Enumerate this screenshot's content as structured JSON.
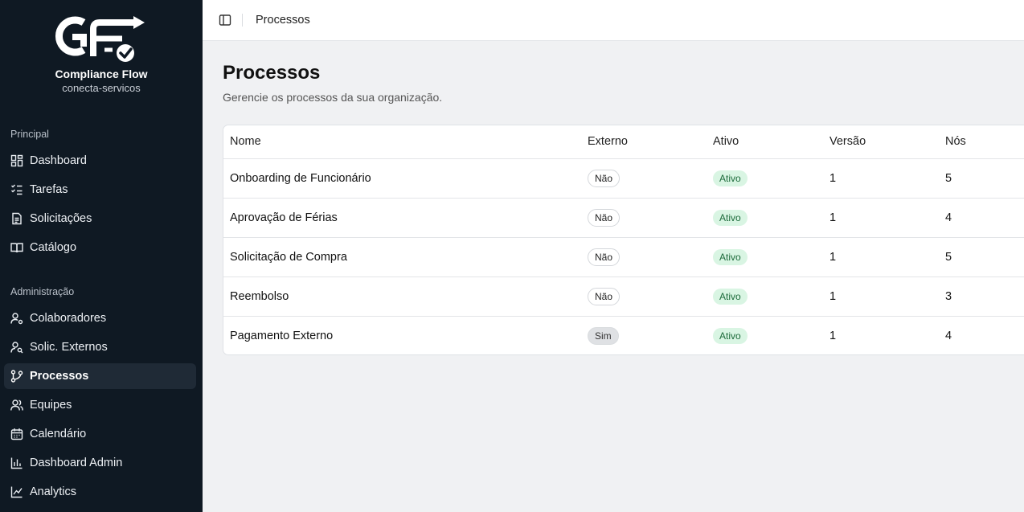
{
  "brand": {
    "name": "Compliance Flow",
    "org": "conecta-servicos"
  },
  "sidebar": {
    "groups": [
      {
        "label": "Principal",
        "items": [
          {
            "label": "Dashboard",
            "icon": "dashboard-icon"
          },
          {
            "label": "Tarefas",
            "icon": "tasks-icon"
          },
          {
            "label": "Solicitações",
            "icon": "document-icon"
          },
          {
            "label": "Catálogo",
            "icon": "book-icon"
          }
        ]
      },
      {
        "label": "Administração",
        "items": [
          {
            "label": "Colaboradores",
            "icon": "users-gear-icon"
          },
          {
            "label": "Solic. Externos",
            "icon": "user-search-icon"
          },
          {
            "label": "Processos",
            "icon": "git-branch-icon",
            "active": true
          },
          {
            "label": "Equipes",
            "icon": "team-icon"
          },
          {
            "label": "Calendário",
            "icon": "calendar-icon"
          },
          {
            "label": "Dashboard Admin",
            "icon": "bar-chart-icon"
          },
          {
            "label": "Analytics",
            "icon": "line-chart-icon"
          }
        ]
      }
    ]
  },
  "topbar": {
    "breadcrumb": "Processos"
  },
  "page": {
    "title": "Processos",
    "subtitle": "Gerencie os processos da sua organização."
  },
  "table": {
    "columns": [
      "Nome",
      "Externo",
      "Ativo",
      "Versão",
      "Nós"
    ],
    "rows": [
      {
        "nome": "Onboarding de Funcionário",
        "externo": "Não",
        "ativo": "Ativo",
        "versao": "1",
        "nos": "5"
      },
      {
        "nome": "Aprovação de Férias",
        "externo": "Não",
        "ativo": "Ativo",
        "versao": "1",
        "nos": "4"
      },
      {
        "nome": "Solicitação de Compra",
        "externo": "Não",
        "ativo": "Ativo",
        "versao": "1",
        "nos": "5"
      },
      {
        "nome": "Reembolso",
        "externo": "Não",
        "ativo": "Ativo",
        "versao": "1",
        "nos": "3"
      },
      {
        "nome": "Pagamento Externo",
        "externo": "Sim",
        "ativo": "Ativo",
        "versao": "1",
        "nos": "4"
      }
    ]
  },
  "colors": {
    "sidebar_bg": "#0f1923",
    "active_bg": "#1f2a36",
    "active_badge_bg": "#d9f5e3",
    "active_badge_text": "#1d6b3b"
  }
}
